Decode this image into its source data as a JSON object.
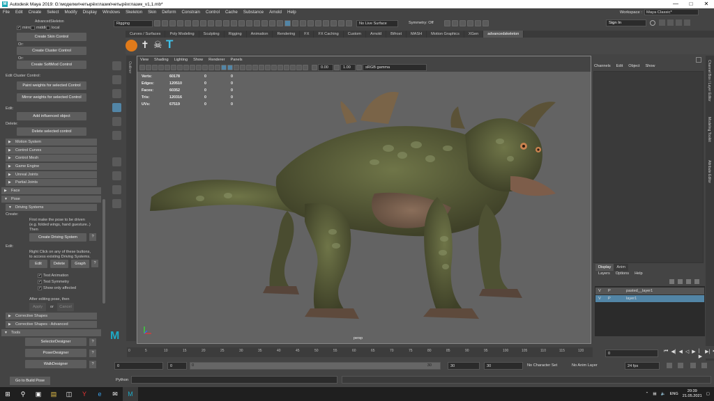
{
  "window": {
    "title": "Autodesk Maya 2019: G:\\моделки\\четырёхглазик\\четырёхглазик_v1,1.mb*"
  },
  "menubar": [
    "File",
    "Edit",
    "Create",
    "Select",
    "Modify",
    "Display",
    "Windows",
    "Skeleton",
    "Skin",
    "Deform",
    "Constrain",
    "Control",
    "Cache",
    "Substance",
    "Arnold",
    "Help"
  ],
  "workspace": {
    "label": "Workspace :",
    "value": "Maya Classic*"
  },
  "statusline": {
    "menuset": "Rigging",
    "live": "No Live Surface",
    "symmetry": "Symmetry: Off",
    "signin": "Sign In"
  },
  "shelf_tabs": [
    "Curves / Surfaces",
    "Poly Modeling",
    "Sculpting",
    "Rigging",
    "Animation",
    "Rendering",
    "FX",
    "FX Caching",
    "Custom",
    "Arnold",
    "Bifrost",
    "MASH",
    "Motion Graphics",
    "XGen",
    "advancedskeleton"
  ],
  "shelf_active": "advancedskeleton",
  "left": {
    "header": "AdvancedSkeleton",
    "opts": {
      "mirror": "mirror",
      "middle": "middle",
      "local": "local"
    },
    "create_skin": "Create Skin Control",
    "or1": "Or:",
    "create_cluster": "Create Cluster Control",
    "or2": "Or:",
    "create_softmod": "Create SoftMod Control",
    "edit_cluster": "Edit Cluster Control:",
    "paint_weights": "Paint weights for selected Control",
    "mirror_weights": "Mirror weights for selected Control",
    "edit": "Edit:",
    "add_influenced": "Add influenced object",
    "delete": "Delete:",
    "delete_selected": "Delete selected control",
    "sections": [
      "Motion System",
      "Control Curves",
      "Control Mesh",
      "Game Engine",
      "Unreal Joints",
      "Partial Joints"
    ],
    "face": "Face",
    "pose": "Pose",
    "driving": "Driving Systems",
    "create_label": "Create:",
    "create_help1": "First make the pose to be driven",
    "create_help2": "(e.g. folded wings, hand guesture..)",
    "create_help3": "Then",
    "create_driving": "Create Driving System",
    "edit2": "Edit:",
    "edit_help1": "Right Click on any of these buttons,",
    "edit_help2": "to access existing Driving Systems.",
    "btn_edit": "Edit",
    "btn_delete": "Delete",
    "btn_graph": "Graph",
    "test_animation": "Test Animation",
    "test_symmetry": "Test Symmetry",
    "show_only": "Show only affected",
    "after_edit": "After editing pose, then",
    "apply": "Apply",
    "or3": "or",
    "cancel": "Cancel",
    "corrective": "Corrective Shapes",
    "corrective_adv": "Corrective Shapes - Advanced",
    "tools": "Tools",
    "selector": "SelectorDesigner",
    "poser": "PoserDesigner",
    "walk": "WalkDesigner",
    "q": "?",
    "goto_build": "Go to Build Pose"
  },
  "viewport": {
    "menu": [
      "View",
      "Shading",
      "Lighting",
      "Show",
      "Renderer",
      "Panels"
    ],
    "exposure": "0.00",
    "gamma": "1.00",
    "colorspace": "sRGB gamma",
    "hud": [
      {
        "k": "Verts:",
        "a": "60178",
        "b": "0",
        "c": "0"
      },
      {
        "k": "Edges:",
        "a": "120510",
        "b": "0",
        "c": "0"
      },
      {
        "k": "Faces:",
        "a": "60352",
        "b": "0",
        "c": "0"
      },
      {
        "k": "Tris:",
        "a": "120316",
        "b": "0",
        "c": "0"
      },
      {
        "k": "UVs:",
        "a": "67519",
        "b": "0",
        "c": "0"
      }
    ],
    "camera": "persp"
  },
  "outliner_label": "Outliner",
  "right": {
    "menu": [
      "Channels",
      "Edit",
      "Object",
      "Show"
    ],
    "tabs": [
      "Display",
      "Anim"
    ],
    "layer_menu": [
      "Layers",
      "Options",
      "Help"
    ],
    "layers": [
      {
        "v": "V",
        "p": "P",
        "name": "pasted__layer1"
      },
      {
        "v": "V",
        "p": "P",
        "name": "layer1"
      }
    ],
    "side_tabs": [
      "Channel Box / Layer Editor",
      "Modeling Toolkit",
      "Attribute Editor"
    ]
  },
  "timeline": {
    "ticks": [
      "5",
      "10",
      "15",
      "20",
      "25",
      "30",
      "35",
      "40",
      "45",
      "50",
      "55",
      "60",
      "65",
      "70",
      "75",
      "80",
      "85",
      "90",
      "95",
      "100",
      "105",
      "110",
      "115",
      "120"
    ],
    "start_tick": "0",
    "current": "0"
  },
  "range": {
    "start": "0",
    "inner_start": "0",
    "inner_end": "30",
    "end1": "30",
    "end2": "30",
    "character": "No Character Set",
    "animlayer": "No Anim Layer",
    "fps": "24 fps"
  },
  "cmd": {
    "label": "Python"
  },
  "tray": {
    "lang": "ENG",
    "time": "20:39",
    "date": "21.05.2021"
  }
}
